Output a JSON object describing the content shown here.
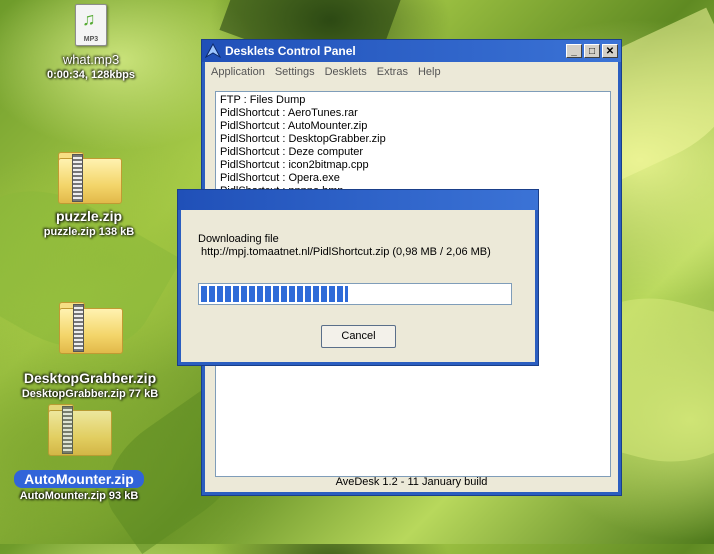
{
  "desktop": {
    "icons": [
      {
        "name": "what.mp3",
        "sub": "0:00:34, 128kbps",
        "type": "mp3",
        "badge": "MP3"
      },
      {
        "name": "puzzle.zip",
        "sub": "puzzle.zip 138 kB",
        "type": "zip"
      },
      {
        "name": "DesktopGrabber.zip",
        "sub": "DesktopGrabber.zip 77 kB",
        "type": "zip"
      },
      {
        "name": "AutoMounter.zip",
        "sub": "AutoMounter.zip 93 kB",
        "type": "zip",
        "selected": true
      }
    ]
  },
  "window": {
    "title": "Desklets Control Panel",
    "menu": [
      "Application",
      "Settings",
      "Desklets",
      "Extras",
      "Help"
    ],
    "list": [
      "FTP : Files Dump",
      "PidlShortcut : AeroTunes.rar",
      "PidlShortcut : AutoMounter.zip",
      "PidlShortcut : DesktopGrabber.zip",
      "PidlShortcut : Deze computer",
      "PidlShortcut : icon2bitmap.cpp",
      "PidlShortcut : Opera.exe",
      "PidlShortcut : pppne.bmp"
    ],
    "status": "AveDesk 1.2 -  11 January build"
  },
  "dialog": {
    "label": "Downloading file",
    "url": "http://mpj.tomaatnet.nl/PidlShortcut.zip  (0,98 MB / 2,06 MB)",
    "progress": 0.476,
    "cancel_label": "Cancel"
  },
  "colors": {
    "title_blue": "#2b5ec0",
    "window_face": "#ece9d8",
    "progress_fill": "#2f6bd8",
    "selection": "#3164d9"
  }
}
